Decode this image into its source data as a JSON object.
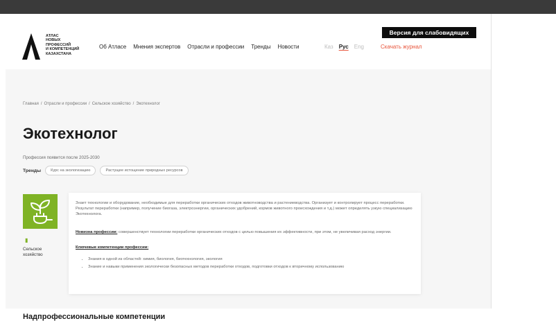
{
  "header": {
    "logo_text": [
      "АТЛАС",
      "НОВЫХ",
      "ПРОФЕССИЙ",
      "И КОМПЕТЕНЦИЙ",
      "КАЗАХСТАНА"
    ],
    "nav": [
      "Об Атласе",
      "Мнения экспертов",
      "Отрасли и профессии",
      "Тренды",
      "Новости"
    ],
    "languages": [
      "Каз",
      "Рус",
      "Eng"
    ],
    "active_language": "Рус",
    "download_label": "Скачать журнал",
    "vision_button": "Версия для слабовидящих"
  },
  "breadcrumbs": [
    "Главная",
    "Отрасли и профессии",
    "Сельское хозяйство",
    "Экотехнолог"
  ],
  "profession": {
    "title": "Экотехнолог",
    "appears": "Профессия появится после 2025-2030",
    "trends_label": "Тренды",
    "trends": [
      "Курс на экологизацию",
      "Растущее истощение природных ресурсов"
    ],
    "sector": [
      "Сельское",
      "хозяйство"
    ],
    "description": "Знает технологии и оборудование, необходимые для переработки органических отходов животноводства и растениеводства. Организует и контролирует процесс переработки. Результат переработки (например, получение биогаза, электроэнергии, органических удобрений, кормов животного происхождения и т.д.) может определять узкую специализацию Экотехнолога.",
    "novelty_label": "Новизна профессии:",
    "novelty_text": " совершенствует технологии переработки органических отходов с целью повышения их эффективности, при этом, не увеличивая расход энергии.",
    "key_competencies_label": "Ключевые компетенции профессии:",
    "key_competencies": [
      "Знания в одной из областей: химия, биология, биотехнология, экология",
      "Знание и навыки применения экологически безопасных методов переработки отходов, подготовки отходов к вторичному использованию"
    ]
  },
  "section_title": "Надпрофессиональные компетенции",
  "colors": {
    "accent": "#e8543a",
    "sector": "#7fb325",
    "dark": "#0d0d0d"
  },
  "icons": {
    "logo": "atlas-logo",
    "sector": "plant-plug-icon",
    "sector_small": "battery-icon"
  }
}
